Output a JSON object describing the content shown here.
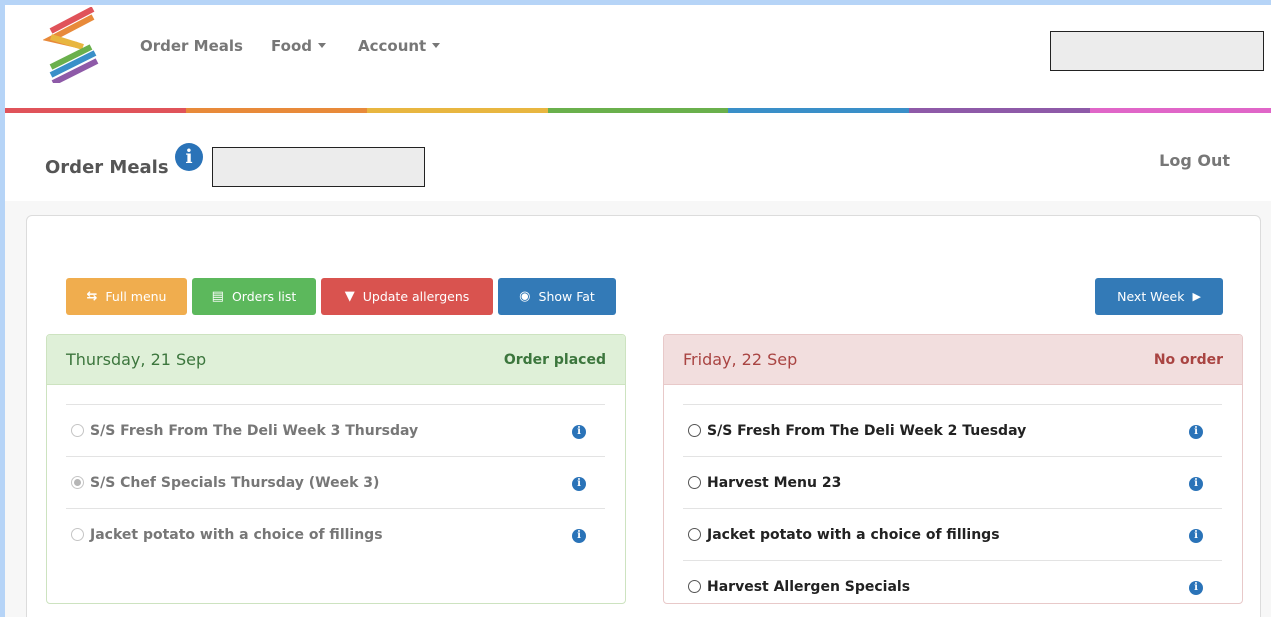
{
  "colors": {
    "rainbow": [
      "#e0535a",
      "#e88a3a",
      "#e8b640",
      "#6ab04c",
      "#3a8fc8",
      "#8e5aa8",
      "#e066c8"
    ],
    "btn_orange": "#f0ad4e",
    "btn_green": "#5cb85c",
    "btn_red": "#d9534f",
    "btn_blue": "#337ab7",
    "placed_bg": "#dff0d8",
    "placed_text": "#3c763d",
    "noorder_bg": "#f2dede",
    "noorder_text": "#a94442"
  },
  "nav": {
    "items": [
      {
        "label": "Order Meals",
        "dropdown": false
      },
      {
        "label": "Food",
        "dropdown": true
      },
      {
        "label": "Account",
        "dropdown": true
      }
    ]
  },
  "header": {
    "title": "Order Meals",
    "info_icon": "i",
    "logout": "Log Out"
  },
  "toolbar": {
    "full_menu": "Full menu",
    "full_menu_icon": "⇆",
    "orders_list": "Orders list",
    "orders_list_icon": "▤",
    "update_allergens": "Update allergens",
    "update_allergens_icon": "▼",
    "show_fat": "Show Fat",
    "show_fat_icon": "◉",
    "next_week": "Next Week",
    "next_week_icon": "▶"
  },
  "days": [
    {
      "date": "Thursday, 21 Sep",
      "status": "Order placed",
      "items": [
        {
          "label": "S/S Fresh From The Deli Week 3 Thursday",
          "selected": false,
          "disabled": true
        },
        {
          "label": "S/S Chef Specials Thursday (Week 3)",
          "selected": true,
          "disabled": true
        },
        {
          "label": "Jacket potato with a choice of fillings",
          "selected": false,
          "disabled": true
        }
      ]
    },
    {
      "date": "Friday, 22 Sep",
      "status": "No order",
      "items": [
        {
          "label": "S/S Fresh From The Deli Week 2 Tuesday",
          "selected": false,
          "disabled": false
        },
        {
          "label": "Harvest Menu 23",
          "selected": false,
          "disabled": false
        },
        {
          "label": "Jacket potato with a choice of fillings",
          "selected": false,
          "disabled": false
        },
        {
          "label": "Harvest Allergen Specials",
          "selected": false,
          "disabled": false
        }
      ]
    }
  ]
}
